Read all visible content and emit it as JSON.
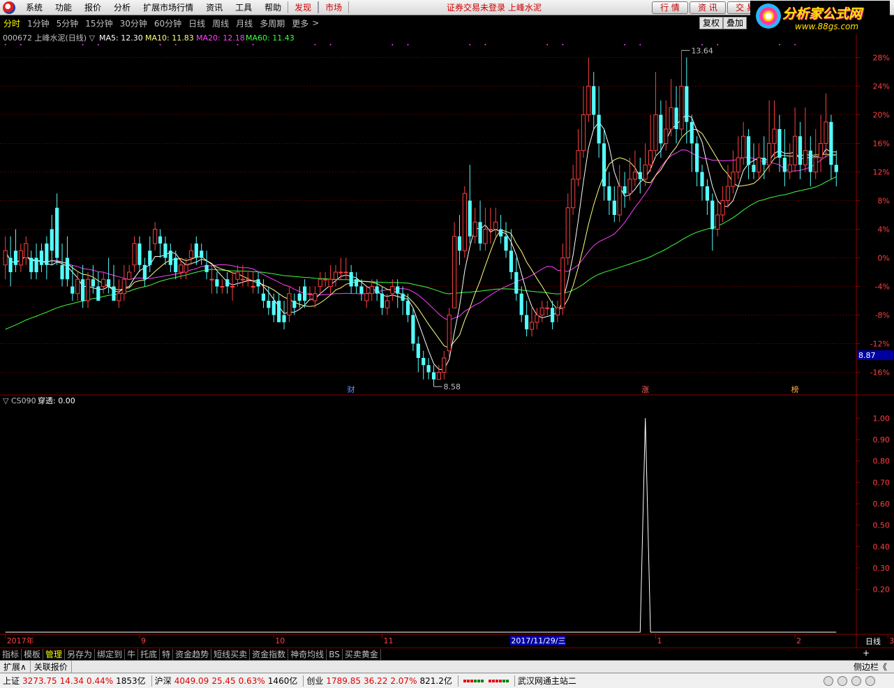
{
  "menubar": {
    "items": [
      "系统",
      "功能",
      "报价",
      "分析",
      "扩展市场行情",
      "资讯",
      "工具",
      "帮助"
    ],
    "highlight_items": [
      "发现",
      "市场"
    ],
    "notice": "证券交易未登录 上峰水泥",
    "right_buttons": [
      "行 情",
      "资 讯",
      "交 易"
    ]
  },
  "site_logo": {
    "name": "分析家公式网",
    "url": "www.88gs.com"
  },
  "periods": {
    "items": [
      "分时",
      "1分钟",
      "5分钟",
      "15分钟",
      "30分钟",
      "60分钟",
      "日线",
      "周线",
      "月线",
      "多周期",
      "更多"
    ],
    "active": "分时",
    "more_arrow": ">",
    "right_tools": [
      "复权",
      "叠加"
    ]
  },
  "main": {
    "stock_title": "000672 上峰水泥(日线) ▽",
    "ma5": "MA5: 12.30",
    "ma10": "MA10: 11.83",
    "ma20": "MA20: 12.18",
    "ma60": "MA60: 11.43",
    "colors": {
      "up": "#ff4040",
      "down": "#54ffff",
      "ma5": "#ffffff",
      "ma10": "#ffff80",
      "ma20": "#ff40ff",
      "ma60": "#40ff40",
      "grid": "#900000",
      "axis_text": "#ff4040"
    },
    "price_axis": [
      "28%",
      "24%",
      "20%",
      "16%",
      "12%",
      "8%",
      "4%",
      "0%",
      "-4%",
      "-8%",
      "-12%",
      "-16%"
    ],
    "current_price": "8.87",
    "high_label": "13.64",
    "low_label": "8.58",
    "event_badges": [
      {
        "label": "财",
        "index": 67,
        "color": "#6090ff"
      },
      {
        "label": "涨",
        "index": 124,
        "color": "#ff6060"
      },
      {
        "label": "榜",
        "index": 153,
        "color": "#ffb040"
      }
    ]
  },
  "sub": {
    "title": "▽ CS090",
    "indicator": "穿透: 0.00",
    "axis": [
      "1.00",
      "0.90",
      "0.80",
      "0.70",
      "0.60",
      "0.50",
      "0.40",
      "0.30",
      "0.20"
    ]
  },
  "time_axis": {
    "labels": [
      {
        "text": "2017年",
        "index": 0
      },
      {
        "text": "9",
        "index": 26
      },
      {
        "text": "10",
        "index": 52
      },
      {
        "text": "11",
        "index": 73
      },
      {
        "text": "1",
        "index": 126
      },
      {
        "text": "2",
        "index": 153
      },
      {
        "text": "3",
        "index": 171
      }
    ],
    "cursor_date": "2017/11/29/三",
    "cursor_index": 98,
    "period": "日线"
  },
  "bottom_tabs": {
    "items": [
      "指标",
      "模板",
      "管理",
      "另存为",
      "绑定到",
      "牛",
      "托底",
      "特",
      "资金趋势",
      "短线买卖",
      "资金指数",
      "神奇均线",
      "BS",
      "买卖黄金"
    ],
    "active": "管理",
    "plus": "+"
  },
  "ext_row": {
    "items": [
      "扩展∧",
      "关联报价"
    ],
    "side": "侧边栏《"
  },
  "statusbar": {
    "sh": {
      "name": "上证",
      "price": "3273.75",
      "chg": "14.34",
      "pct": "0.44%",
      "amt": "1853亿"
    },
    "hs": {
      "name": "沪深",
      "price": "4049.09",
      "chg": "25.45",
      "pct": "0.63%",
      "amt": "1460亿"
    },
    "cy": {
      "name": "创业",
      "price": "1789.85",
      "chg": "36.22",
      "pct": "2.07%",
      "amt": "821.2亿"
    },
    "server": "武汉网通主站二"
  },
  "chart_data": {
    "type": "candlestick",
    "scale": "percent",
    "ylim": [
      -18,
      30
    ],
    "candles": [
      [
        -1,
        1,
        -3,
        3
      ],
      [
        0,
        -2,
        -4,
        3
      ],
      [
        1,
        -1,
        -2,
        4
      ],
      [
        -1,
        1,
        -2,
        2
      ],
      [
        0,
        2,
        -1,
        3
      ],
      [
        0,
        -2,
        -3,
        1
      ],
      [
        0,
        -2,
        -3,
        2
      ],
      [
        1,
        -1,
        -2,
        2
      ],
      [
        2,
        -1,
        -3,
        3
      ],
      [
        4,
        1,
        -1,
        6
      ],
      [
        7,
        0,
        -1,
        9
      ],
      [
        -1,
        -3,
        -4,
        2
      ],
      [
        0,
        -3,
        -4,
        3
      ],
      [
        -4,
        -5,
        -6,
        -1
      ],
      [
        -5,
        -3,
        -6,
        -2
      ],
      [
        -3,
        -6,
        -7,
        -1
      ],
      [
        -6,
        -3,
        -7,
        -2
      ],
      [
        -3,
        -4,
        -5,
        -1
      ],
      [
        -4,
        -6,
        -6,
        -2
      ],
      [
        -4,
        -3,
        -5,
        -2
      ],
      [
        -3,
        -4,
        -5,
        0
      ],
      [
        -4,
        -6,
        -6,
        -1
      ],
      [
        -6,
        -5,
        -7,
        -3
      ],
      [
        -5,
        -3,
        -6,
        -1
      ],
      [
        -3,
        -2,
        -3,
        -1
      ],
      [
        -1,
        2,
        -2,
        3
      ],
      [
        2,
        -1,
        -2,
        3
      ],
      [
        -1,
        -3,
        -4,
        0
      ],
      [
        1,
        -1,
        -2,
        3
      ],
      [
        2,
        4,
        1,
        5
      ],
      [
        3,
        2,
        0,
        4
      ],
      [
        2,
        0,
        -1,
        3
      ],
      [
        1,
        -1,
        -2,
        2
      ],
      [
        0,
        -2,
        -3,
        1
      ],
      [
        -2,
        -1,
        -3,
        0
      ],
      [
        -2,
        -1,
        -3,
        0
      ],
      [
        0,
        1,
        -1,
        2
      ],
      [
        2,
        0,
        -1,
        3
      ],
      [
        1,
        0,
        -1,
        2
      ],
      [
        -1,
        -2,
        -3,
        1
      ],
      [
        -3,
        -3,
        -5,
        -1
      ],
      [
        -3,
        -4,
        -5,
        -2
      ],
      [
        -4,
        -4,
        -5,
        -3
      ],
      [
        -3,
        -4,
        -5,
        -2
      ],
      [
        -4,
        -4,
        -6,
        -2
      ],
      [
        -3,
        -2,
        -4,
        -1
      ],
      [
        -3,
        -3,
        -4,
        -1
      ],
      [
        -3,
        -3,
        -4,
        -2
      ],
      [
        -4,
        -4,
        -5,
        -2
      ],
      [
        -3,
        -4,
        -5,
        -2
      ],
      [
        -5,
        -6,
        -7,
        -3
      ],
      [
        -6,
        -7,
        -8,
        -4
      ],
      [
        -6,
        -8,
        -9,
        -5
      ],
      [
        -6,
        -9,
        -9,
        -5
      ],
      [
        -8,
        -9,
        -10,
        -6
      ],
      [
        -8,
        -5,
        -9,
        -4
      ],
      [
        -6,
        -7,
        -8,
        -5
      ],
      [
        -5,
        -6,
        -7,
        -4
      ],
      [
        -4,
        -6,
        -7,
        -3
      ],
      [
        -5,
        -5,
        -6,
        -4
      ],
      [
        -6,
        -5,
        -7,
        -4
      ],
      [
        -4,
        -3,
        -5,
        -2
      ],
      [
        -3,
        -3,
        -4,
        -2
      ],
      [
        -4,
        -3,
        -5,
        -1
      ],
      [
        -3,
        -2,
        -4,
        -1
      ],
      [
        -2,
        -2,
        -3,
        0
      ],
      [
        -2,
        -2,
        -3,
        0
      ],
      [
        -2,
        -4,
        -5,
        -1
      ],
      [
        -3,
        -4,
        -5,
        -2
      ],
      [
        -4,
        -5,
        -6,
        -3
      ],
      [
        -6,
        -5,
        -7,
        -4
      ],
      [
        -5,
        -4,
        -6,
        -3
      ],
      [
        -4,
        -5,
        -6,
        -3
      ],
      [
        -5,
        -7,
        -8,
        -4
      ],
      [
        -7,
        -6,
        -8,
        -5
      ],
      [
        -5,
        -4,
        -6,
        -3
      ],
      [
        -4,
        -5,
        -7,
        -3
      ],
      [
        -5,
        -6,
        -8,
        -4
      ],
      [
        -6,
        -8,
        -9,
        -5
      ],
      [
        -8,
        -12,
        -13,
        -7
      ],
      [
        -12,
        -14,
        -16,
        -11
      ],
      [
        -14,
        -15,
        -17,
        -13
      ],
      [
        -15,
        -16,
        -17,
        -14
      ],
      [
        -16,
        -17,
        -18,
        -15
      ],
      [
        -17,
        -16,
        -17,
        -15
      ],
      [
        -16,
        -14,
        -17,
        -13
      ],
      [
        -13,
        -8,
        -14,
        -7
      ],
      [
        -7,
        3,
        -7,
        5
      ],
      [
        3,
        1,
        -1,
        6
      ],
      [
        1,
        9,
        0,
        10
      ],
      [
        8,
        3,
        2,
        13
      ],
      [
        3,
        5,
        2,
        7
      ],
      [
        5,
        2,
        1,
        8
      ],
      [
        2,
        4,
        1,
        7
      ],
      [
        4,
        4,
        2,
        7
      ],
      [
        4,
        5,
        3,
        7
      ],
      [
        4,
        3,
        2,
        6
      ],
      [
        3,
        1,
        0,
        5
      ],
      [
        1,
        -2,
        -3,
        4
      ],
      [
        -2,
        -5,
        -6,
        0
      ],
      [
        -5,
        -8,
        -9,
        -4
      ],
      [
        -8,
        -10,
        -11,
        -6
      ],
      [
        -10,
        -9,
        -11,
        -7
      ],
      [
        -9,
        -8,
        -10,
        -7
      ],
      [
        -8,
        -7,
        -9,
        -6
      ],
      [
        -7,
        -7,
        -8,
        -6
      ],
      [
        -7,
        -9,
        -10,
        -6
      ],
      [
        -8,
        -7,
        -9,
        -6
      ],
      [
        -7,
        0,
        -8,
        2
      ],
      [
        0,
        7,
        -1,
        9
      ],
      [
        7,
        11,
        6,
        13
      ],
      [
        11,
        15,
        10,
        18
      ],
      [
        15,
        20,
        14,
        24
      ],
      [
        20,
        24,
        19,
        28
      ],
      [
        24,
        20,
        18,
        26
      ],
      [
        20,
        16,
        14,
        24
      ],
      [
        16,
        10,
        8,
        18
      ],
      [
        10,
        8,
        6,
        12
      ],
      [
        8,
        6,
        5,
        10
      ],
      [
        6,
        10,
        5,
        13
      ],
      [
        10,
        9,
        7,
        12
      ],
      [
        9,
        11,
        8,
        14
      ],
      [
        11,
        12,
        10,
        15
      ],
      [
        12,
        11,
        9,
        14
      ],
      [
        11,
        13,
        10,
        16
      ],
      [
        13,
        15,
        12,
        20
      ],
      [
        15,
        20,
        14,
        26
      ],
      [
        20,
        16,
        14,
        22
      ],
      [
        16,
        18,
        15,
        22
      ],
      [
        18,
        21,
        17,
        25
      ],
      [
        21,
        18,
        16,
        24
      ],
      [
        18,
        24,
        17,
        29
      ],
      [
        24,
        19,
        16,
        28
      ],
      [
        19,
        16,
        12,
        20
      ],
      [
        16,
        12,
        10,
        17
      ],
      [
        12,
        10,
        8,
        13
      ],
      [
        10,
        8,
        6,
        11
      ],
      [
        8,
        4,
        1,
        9
      ],
      [
        4,
        6,
        3,
        8
      ],
      [
        6,
        8,
        5,
        10
      ],
      [
        8,
        10,
        7,
        13
      ],
      [
        10,
        12,
        9,
        15
      ],
      [
        12,
        14,
        11,
        17
      ],
      [
        14,
        17,
        13,
        19
      ],
      [
        17,
        13,
        11,
        18
      ],
      [
        13,
        12,
        11,
        16
      ],
      [
        12,
        14,
        11,
        16
      ],
      [
        14,
        13,
        11,
        17
      ],
      [
        13,
        16,
        12,
        22
      ],
      [
        16,
        18,
        14,
        22
      ],
      [
        18,
        14,
        12,
        20
      ],
      [
        14,
        12,
        10,
        18
      ],
      [
        12,
        13,
        11,
        16
      ],
      [
        13,
        17,
        12,
        21
      ],
      [
        17,
        13,
        11,
        19
      ],
      [
        13,
        15,
        12,
        21
      ],
      [
        15,
        12,
        10,
        17
      ],
      [
        12,
        14,
        11,
        18
      ],
      [
        14,
        16,
        12,
        20
      ],
      [
        16,
        19,
        14,
        23
      ],
      [
        19,
        13,
        11,
        20
      ],
      [
        13,
        12,
        10,
        15
      ]
    ],
    "sub_series": {
      "spike_index": 124,
      "spike_value": 1.0,
      "ylim": [
        0.0,
        1.05
      ]
    }
  }
}
